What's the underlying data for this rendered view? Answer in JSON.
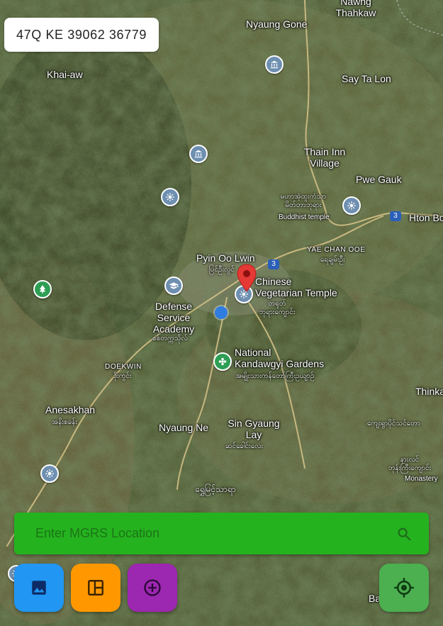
{
  "mgrs_display": "47Q KE 39062 36779",
  "search": {
    "placeholder": "Enter MGRS Location"
  },
  "colors": {
    "search_bar": "#25b21f",
    "gallery_button": "#2196f3",
    "layout_button": "#ff9800",
    "add_button": "#9c27b0",
    "locate_button": "#4caf50",
    "selected_marker": "#e53935",
    "my_location_dot": "#2f7de1"
  },
  "buttons": [
    {
      "id": "gallery",
      "icon": "image-icon"
    },
    {
      "id": "layout",
      "icon": "layout-panel-icon"
    },
    {
      "id": "add",
      "icon": "add-circle-icon"
    },
    {
      "id": "my_location",
      "icon": "gps-crosshair-icon"
    }
  ],
  "map": {
    "places": {
      "nawng_thahkaw": "Nawng\nThahkaw",
      "nyaung_gone": "Nyaung Gone",
      "khai_aw": "Khai-aw",
      "say_ta_lon": "Say Ta Lon",
      "thain_inn": "Thain Inn\nVillage",
      "pwe_gauk": "Pwe Gauk",
      "hton_bo": "Hton Bo",
      "buddhist_temple_mm": "မဟာအံ့ထူးကံသာ\nမိတ်တာဘုရား",
      "buddhist_temple": "Buddhist temple",
      "yae_chan_oo": "YAE CHAN OOE",
      "yae_chan_oo_mm": "ရေချမ်းဦး",
      "pyin_oo_lwin": "Pyin Oo Lwin",
      "pyin_oo_lwin_mm": "ပြင်ဦးလွင်",
      "chinese_temple": "Chinese\nVegetarian Temple",
      "chinese_temple_mm": "တရုတ်\nဘုရားကျောင်း",
      "defense_academy": "Defense\nService\nAcademy",
      "defense_academy_mm": "စစ်တက္ကသိုလ်",
      "doekwin": "DOEKWIN",
      "doekwin_mm": "ဒိုးကွင်း",
      "kandawgyi": "National\nKandawgyi Gardens",
      "kandawgyi_mm": "အမျိုးသားကန်တော်ကြီးဥယျာဉ်",
      "anesakhan": "Anesakhan",
      "anesakhan_mm": "အနိးစခန်း",
      "nyaung_ne": "Nyaung Ne",
      "sin_gyaung_lay": "Sin Gyaung\nLay",
      "sin_gyaung_lay_mm": "ဆင်ခေါင်းလေး",
      "thinka": "Thinka",
      "kyaung_mm": "ကျေးရွာပိုင်သင်တော",
      "monastery_mm": "နားလင်\nဘုန်းကြီးကျောင်း",
      "monastery": "Monastery",
      "shwe_myin_thar_ya_mm": "ရွှေမြင့်သာရာ",
      "bottom_right": "Ba"
    },
    "road_shields": [
      "3",
      "3"
    ]
  }
}
